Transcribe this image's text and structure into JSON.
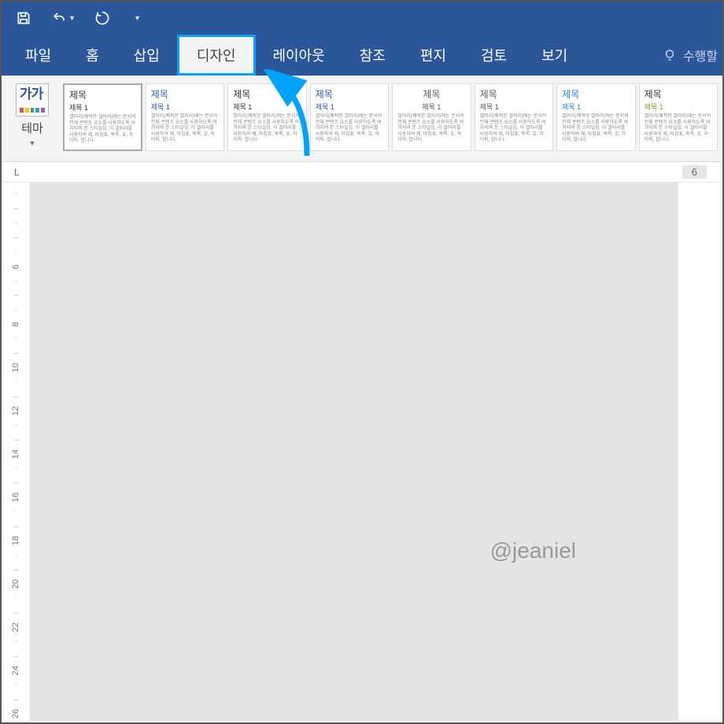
{
  "qat": {
    "save": "save-icon",
    "undo": "undo-icon",
    "redo": "redo-icon"
  },
  "tabs": {
    "file": "파일",
    "home": "홈",
    "insert": "삽입",
    "design": "디자인",
    "layout": "레이아웃",
    "references": "참조",
    "mailings": "편지",
    "review": "검토",
    "view": "보기",
    "tell": "수행할"
  },
  "theme": {
    "thumb_text": "가가",
    "label": "테마",
    "colors": [
      "#e74c3c",
      "#f1c40f",
      "#27ae60",
      "#3498db",
      "#9b59b6"
    ]
  },
  "styles": [
    {
      "title": "제목",
      "title_color": "#333333",
      "sub": "제목 1",
      "selected": true
    },
    {
      "title": "제목",
      "title_color": "#2b579a",
      "sub": "제목 1"
    },
    {
      "title": "제목",
      "title_color": "#333333",
      "sub": "제목 1"
    },
    {
      "title": "제목",
      "title_color": "#2b579a",
      "sub": "제목 1"
    },
    {
      "title": "제목",
      "title_color": "#555555",
      "sub": "제목 1",
      "centered": true
    },
    {
      "title": "제목",
      "title_color": "#555555",
      "sub": "제목 1"
    },
    {
      "title": "제목",
      "title_color": "#2b84c4",
      "sub": "제목 1"
    },
    {
      "title": "제목",
      "title_color": "#333333",
      "sub": "제목 1",
      "green": true
    }
  ],
  "style_body_filler": "갤러리(쾌적한 갤러리)에는 문서의 전체 콘텐츠 요소를 사용하도록 여겨지며 본 스타일임. 이 갤러리를 사용하여 제, 마침표, 목록, 호, 하이퍼, 합니다.",
  "ruler": {
    "corner": "L",
    "right_num": "6",
    "vticks": [
      "·",
      "-",
      "·",
      "-",
      "·",
      "6",
      "·",
      "-",
      "·",
      "8",
      "·",
      "-",
      "10",
      "·",
      "-",
      "12",
      "·",
      "-",
      "14",
      "·",
      "-",
      "16",
      "·",
      "-",
      "18",
      "·",
      "-",
      "20",
      "·",
      "-",
      "22",
      "·",
      "-",
      "24",
      "·",
      "-",
      "26"
    ]
  },
  "watermark": "@jeaniel"
}
